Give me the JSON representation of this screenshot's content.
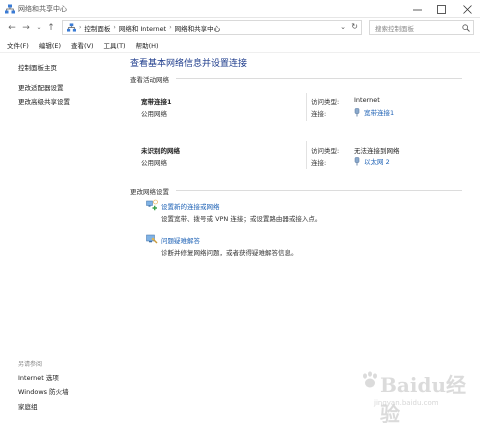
{
  "window": {
    "title": "网络和共享中心"
  },
  "address": {
    "crumbs": [
      "控制面板",
      "网络和 Internet",
      "网络和共享中心"
    ],
    "search_placeholder": "搜索控制面板"
  },
  "menu": [
    "文件(F)",
    "编辑(E)",
    "查看(V)",
    "工具(T)",
    "帮助(H)"
  ],
  "sidebar": {
    "top_links": [
      "控制面板主页",
      "更改适配器设置",
      "更改高级共享设置"
    ],
    "see_also_title": "另请参阅",
    "see_also_links": [
      "Internet 选项",
      "Windows 防火墙",
      "家庭组"
    ]
  },
  "main": {
    "heading": "查看基本网络信息并设置连接",
    "active_section": "查看活动网络",
    "networks": [
      {
        "name": "宽带连接1",
        "category": "公用网络",
        "access_label": "访问类型:",
        "access_value": "Internet",
        "conn_label": "连接:",
        "conn_value": "宽带连接1"
      },
      {
        "name": "未识别的网络",
        "category": "公用网络",
        "access_label": "访问类型:",
        "access_value": "无法连接到网络",
        "conn_label": "连接:",
        "conn_value": "以太网 2"
      }
    ],
    "change_section": "更改网络设置",
    "settings": [
      {
        "link": "设置新的连接或网络",
        "desc": "设置宽带、拨号或 VPN 连接；或设置路由器或接入点。"
      },
      {
        "link": "问题疑难解答",
        "desc": "诊断并修复网络问题，或者获得疑难解答信息。"
      }
    ]
  },
  "watermark": {
    "text1": "Baidu经验",
    "text2": "jingyan.baidu.com"
  }
}
